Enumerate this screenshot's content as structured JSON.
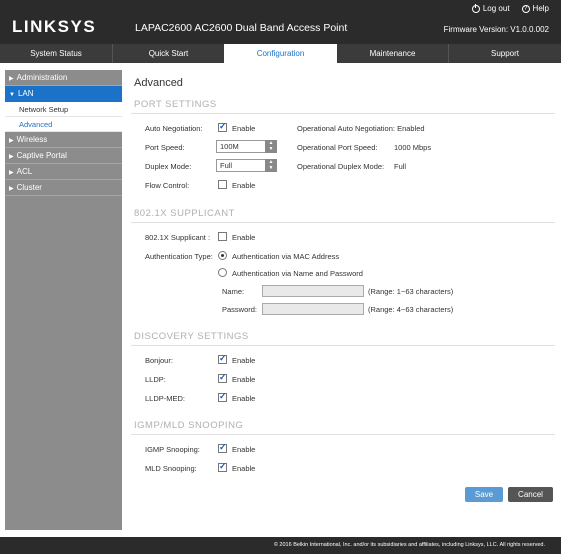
{
  "header": {
    "logo": "LINKSYS",
    "product_title": "LAPAC2600 AC2600 Dual Band Access Point",
    "logout_label": "Log out",
    "help_label": "Help",
    "firmware": "Firmware Version: V1.0.0.002"
  },
  "nav": {
    "tabs": [
      {
        "label": "System Status"
      },
      {
        "label": "Quick Start"
      },
      {
        "label": "Configuration"
      },
      {
        "label": "Maintenance"
      },
      {
        "label": "Support"
      }
    ],
    "active_tab": "Configuration"
  },
  "sidebar": {
    "items": [
      {
        "label": "Administration"
      },
      {
        "label": "LAN"
      },
      {
        "label": "Network Setup"
      },
      {
        "label": "Advanced"
      },
      {
        "label": "Wireless"
      },
      {
        "label": "Captive Portal"
      },
      {
        "label": "ACL"
      },
      {
        "label": "Cluster"
      }
    ]
  },
  "main": {
    "page_title": "Advanced",
    "port_settings": {
      "title": "PORT SETTINGS",
      "auto_negotiation_label": "Auto Negotiation:",
      "auto_negotiation_enable": "Enable",
      "auto_negotiation_checked": true,
      "op_auto_negotiation": "Operational Auto Negotiation: Enabled",
      "port_speed_label": "Port Speed:",
      "port_speed_value": "100M",
      "op_port_speed_label": "Operational Port Speed:",
      "op_port_speed_value": "1000 Mbps",
      "duplex_label": "Duplex Mode:",
      "duplex_value": "Full",
      "op_duplex_label": "Operational Duplex Mode:",
      "op_duplex_value": "Full",
      "flow_control_label": "Flow Control:",
      "flow_control_enable": "Enable",
      "flow_control_checked": false
    },
    "supplicant": {
      "title": "802.1X SUPPLICANT",
      "supplicant_label": "802.1X Supplicant :",
      "supplicant_enable": "Enable",
      "supplicant_checked": false,
      "auth_type_label": "Authentication Type:",
      "auth_mac": "Authentication via MAC Address",
      "auth_name_password": "Authentication via Name and Password",
      "name_label": "Name:",
      "name_range": "(Range: 1~63 characters)",
      "password_label": "Password:",
      "password_range": "(Range: 4~63 characters)"
    },
    "discovery": {
      "title": "DISCOVERY SETTINGS",
      "bonjour_label": "Bonjour:",
      "lldp_label": "LLDP:",
      "lldp_med_label": "LLDP-MED:",
      "enable": "Enable"
    },
    "igmp": {
      "title": "IGMP/MLD SNOOPING",
      "igmp_label": "IGMP Snooping:",
      "mld_label": "MLD Snooping:",
      "enable": "Enable"
    },
    "buttons": {
      "save": "Save",
      "cancel": "Cancel"
    }
  },
  "footer": {
    "copyright": "© 2016 Belkin International, Inc. and/or its subsidiaries and affiliates, including Linksys, LLC. All rights reserved."
  },
  "colors": {
    "header_bg": "#2b2b2b",
    "accent": "#1a73c8",
    "sidebar_bg": "#8c8c8c",
    "save_button": "#5b9bd5"
  }
}
